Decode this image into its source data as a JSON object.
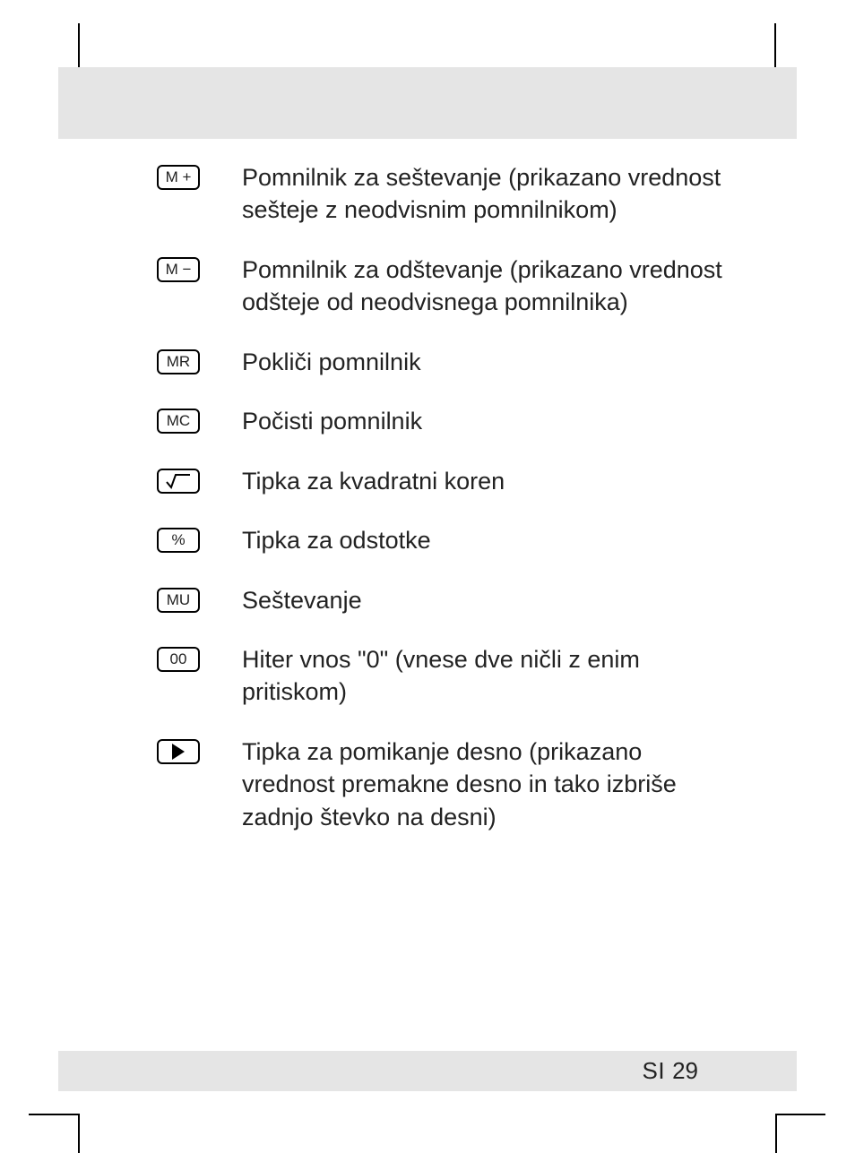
{
  "footer": {
    "lang": "SI",
    "page": "29"
  },
  "items": [
    {
      "key_label": "M +",
      "key_type": "text",
      "description": "Pomnilnik za seštevanje (prikazano vrednost sešteje z neodvisnim pomnilnikom)"
    },
    {
      "key_label": "M −",
      "key_type": "text",
      "description": "Pomnilnik za odštevanje (prikazano vrednost odšteje od neodvisnega pomnilnika)"
    },
    {
      "key_label": "MR",
      "key_type": "text",
      "description": "Pokliči pomnilnik"
    },
    {
      "key_label": "MC",
      "key_type": "text",
      "description": "Počisti pomnilnik"
    },
    {
      "key_label": "√",
      "key_type": "sqrt",
      "description": "Tipka za kvadratni koren"
    },
    {
      "key_label": "%",
      "key_type": "text",
      "description": "Tipka za odstotke"
    },
    {
      "key_label": "MU",
      "key_type": "text",
      "description": "Seštevanje"
    },
    {
      "key_label": "00",
      "key_type": "text",
      "description": "Hiter vnos \"0\" (vnese dve ničli z enim pritiskom)"
    },
    {
      "key_label": "▶",
      "key_type": "play",
      "description": "Tipka za pomikanje desno (prikazano vrednost premakne desno in tako izbriše zadnjo števko na desni)"
    }
  ]
}
